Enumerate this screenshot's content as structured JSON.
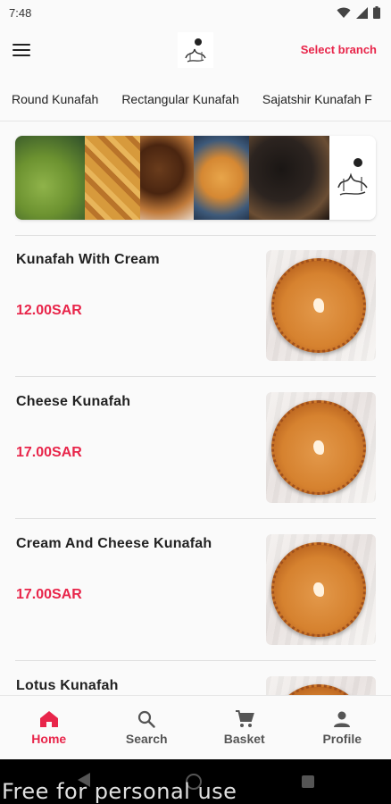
{
  "status_bar": {
    "time": "7:48"
  },
  "header": {
    "select_branch_label": "Select branch",
    "logo_icon": "store-logo-icon"
  },
  "tabs": [
    {
      "label": "Round Kunafah",
      "active": true
    },
    {
      "label": "Rectangular Kunafah",
      "active": false
    },
    {
      "label": "Sajatshir Kunafah F",
      "active": false
    }
  ],
  "menu_items": [
    {
      "name": "Kunafah With Cream",
      "price": "12.00SAR"
    },
    {
      "name": "Cheese Kunafah",
      "price": "17.00SAR"
    },
    {
      "name": "Cream And Cheese Kunafah",
      "price": "17.00SAR"
    },
    {
      "name": "Lotus Kunafah",
      "price": ""
    }
  ],
  "bottom_nav": [
    {
      "label": "Home",
      "icon": "home-icon",
      "active": true
    },
    {
      "label": "Search",
      "icon": "search-icon",
      "active": false
    },
    {
      "label": "Basket",
      "icon": "cart-icon",
      "active": false
    },
    {
      "label": "Profile",
      "icon": "person-icon",
      "active": false
    }
  ],
  "watermark": "Free for personal use",
  "colors": {
    "accent": "#e8254a",
    "tab_indicator": "#f26d7d"
  }
}
